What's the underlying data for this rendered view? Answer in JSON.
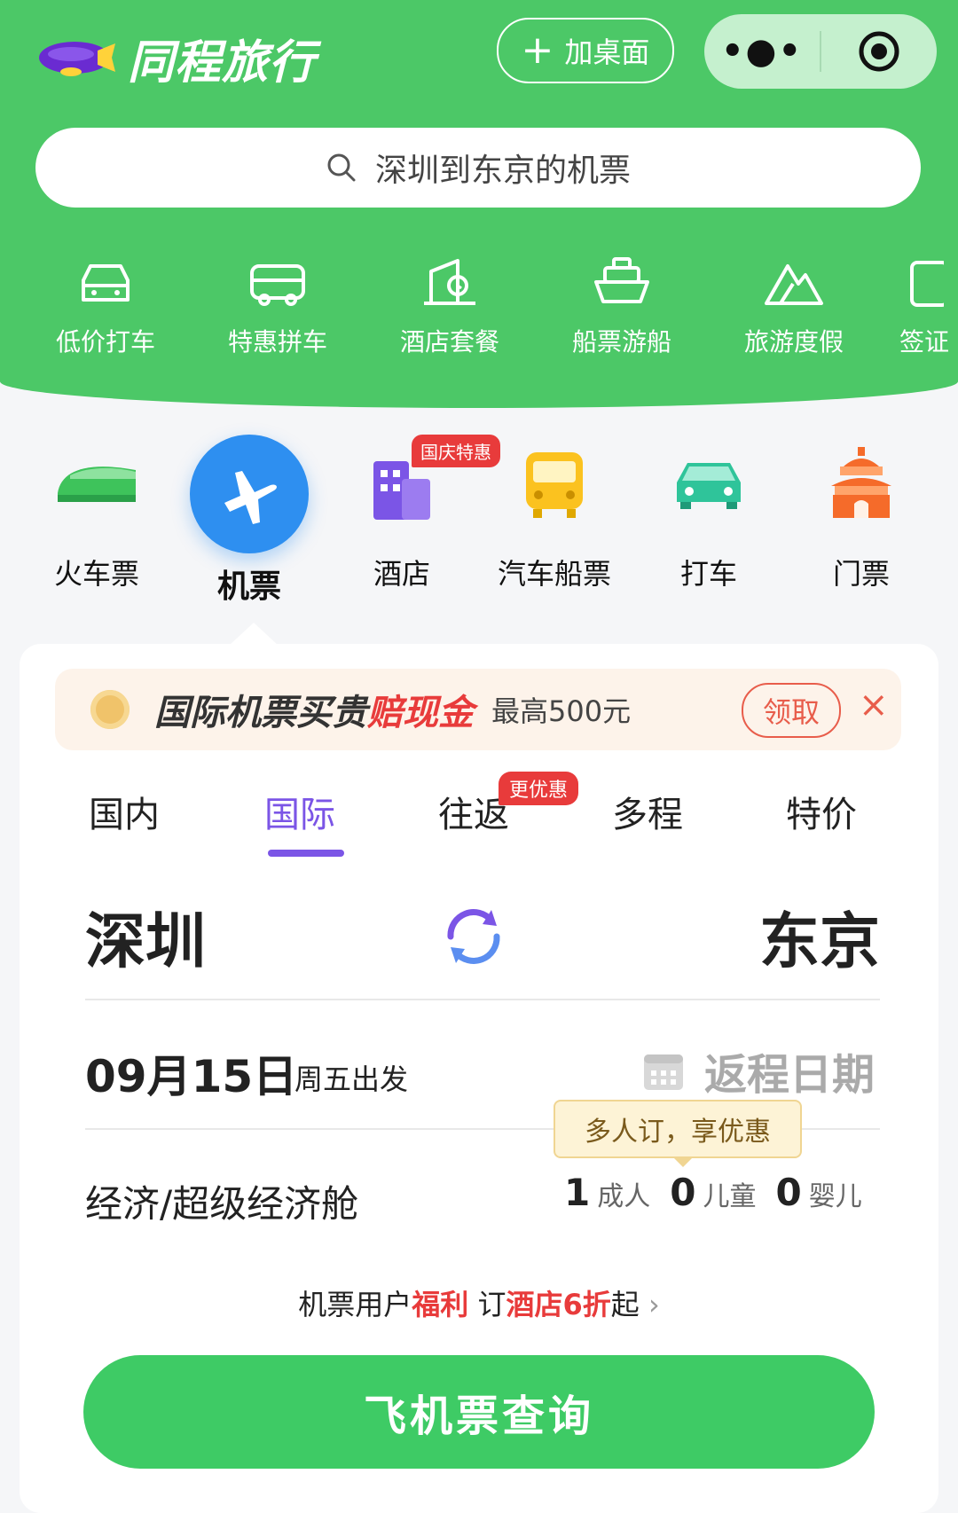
{
  "brand": {
    "name": "同程旅行"
  },
  "topbar": {
    "add_desktop": "加桌面",
    "more": "•●•"
  },
  "search": {
    "placeholder": "深圳到东京的机票"
  },
  "quick_nav": [
    {
      "label": "低价打车",
      "icon": "car-outline-icon"
    },
    {
      "label": "特惠拼车",
      "icon": "van-outline-icon"
    },
    {
      "label": "酒店套餐",
      "icon": "hotel-outline-icon"
    },
    {
      "label": "船票游船",
      "icon": "ship-outline-icon"
    },
    {
      "label": "旅游度假",
      "icon": "mountain-outline-icon"
    },
    {
      "label": "签证",
      "icon": "visa-outline-icon"
    }
  ],
  "services": [
    {
      "label": "火车票",
      "icon": "train-icon"
    },
    {
      "label": "机票",
      "icon": "plane-icon"
    },
    {
      "label": "酒店",
      "icon": "hotel-icon",
      "badge": "国庆特惠"
    },
    {
      "label": "汽车船票",
      "icon": "bus-icon"
    },
    {
      "label": "打车",
      "icon": "taxi-icon"
    },
    {
      "label": "门票",
      "icon": "temple-icon"
    }
  ],
  "promo": {
    "title_main": "国际机票买贵",
    "title_red": "赔现金",
    "subtitle": "最高500元",
    "claim": "领取",
    "close": "×"
  },
  "tabs": [
    {
      "label": "国内"
    },
    {
      "label": "国际",
      "active": true
    },
    {
      "label": "往返",
      "badge": "更优惠"
    },
    {
      "label": "多程"
    },
    {
      "label": "特价"
    }
  ],
  "route": {
    "from": "深圳",
    "to": "东京"
  },
  "date": {
    "value": "09月15日",
    "sub": "周五出发",
    "return_label": "返程日期"
  },
  "tooltip": "多人订，享优惠",
  "cabin": "经济/超级经济舱",
  "passengers": {
    "adult_count": "1",
    "adult_label": "成人",
    "child_count": "0",
    "child_label": "儿童",
    "infant_count": "0",
    "infant_label": "婴儿"
  },
  "benefit": {
    "p1": "机票用户",
    "p2": "福利",
    "p3": " 订",
    "p4": "酒店6折",
    "p5": "起",
    "chev": "›"
  },
  "search_button": "飞机票查询",
  "colors": {
    "primary_green": "#4cc867",
    "purple": "#7b55e6",
    "red": "#e83b3b"
  }
}
